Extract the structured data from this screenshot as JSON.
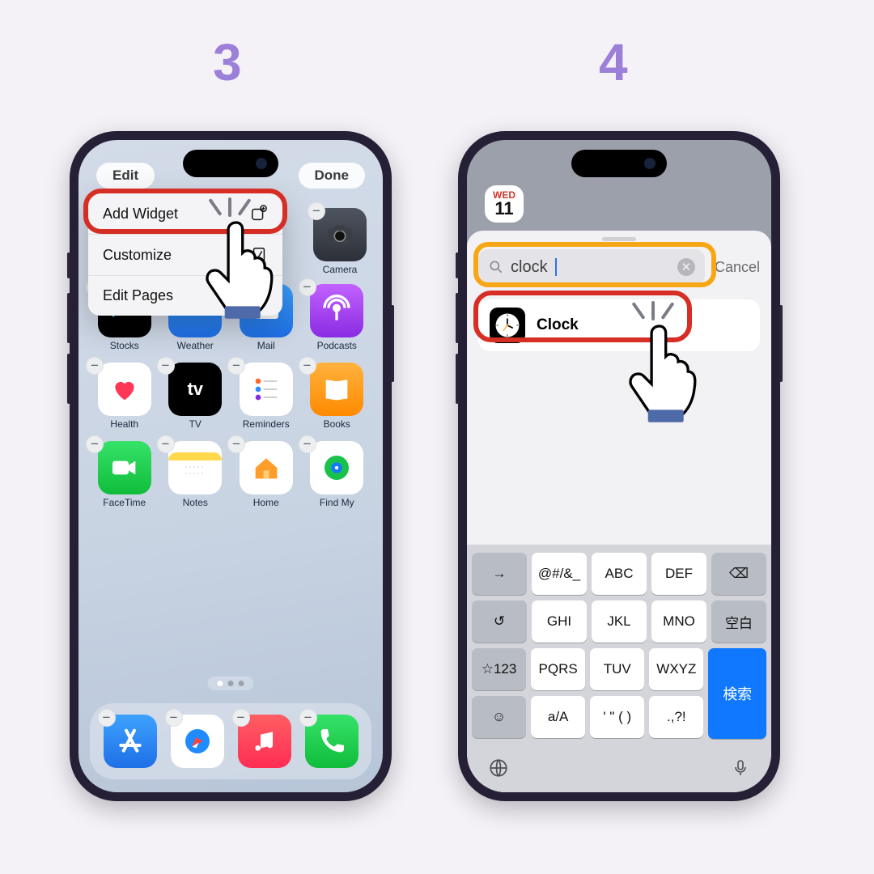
{
  "steps": {
    "left": "3",
    "right": "4"
  },
  "step3": {
    "top_left": "Edit",
    "top_right": "Done",
    "menu": {
      "add_widget": "Add Widget",
      "customize": "Customize",
      "edit_pages": "Edit Pages"
    },
    "apps": [
      {
        "name": "camera",
        "label": "Camera"
      },
      {
        "name": "stocks",
        "label": "Stocks"
      },
      {
        "name": "weather",
        "label": "Weather"
      },
      {
        "name": "mail",
        "label": "Mail"
      },
      {
        "name": "podcasts",
        "label": "Podcasts"
      },
      {
        "name": "health",
        "label": "Health"
      },
      {
        "name": "tv",
        "label": "TV"
      },
      {
        "name": "reminders",
        "label": "Reminders"
      },
      {
        "name": "books",
        "label": "Books"
      },
      {
        "name": "facetime",
        "label": "FaceTime"
      },
      {
        "name": "notes",
        "label": "Notes"
      },
      {
        "name": "home",
        "label": "Home"
      },
      {
        "name": "findmy",
        "label": "Find My"
      }
    ],
    "dock": [
      "appstore",
      "safari",
      "music",
      "phone"
    ]
  },
  "step4": {
    "date_day": "WED",
    "date_num": "11",
    "search_value": "clock",
    "cancel": "Cancel",
    "result_label": "Clock",
    "keyboard": {
      "row1": [
        "→",
        "@#/&_",
        "ABC",
        "DEF",
        "⌫"
      ],
      "row2": [
        "↺",
        "GHI",
        "JKL",
        "MNO",
        "空白"
      ],
      "row3": [
        "☆123",
        "PQRS",
        "TUV",
        "WXYZ",
        ""
      ],
      "row4": [
        "☺",
        "a/A",
        "' \" ( )",
        ".,?!",
        ""
      ],
      "search_label": "検索"
    }
  }
}
